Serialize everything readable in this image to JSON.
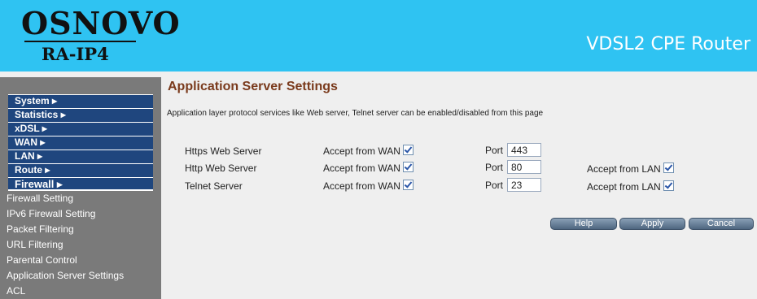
{
  "header": {
    "logo_main": "OSNOVO",
    "logo_sub": "RA-IP4",
    "title": "VDSL2 CPE Router"
  },
  "sidebar": {
    "menu": [
      {
        "label": "System ▸"
      },
      {
        "label": "Statistics ▸"
      },
      {
        "label": "xDSL ▸"
      },
      {
        "label": "WAN ▸"
      },
      {
        "label": "LAN ▸"
      },
      {
        "label": "Route ▸"
      },
      {
        "label": "Firewall ▸"
      }
    ],
    "submenu": [
      {
        "label": "Firewall Setting"
      },
      {
        "label": "IPv6 Firewall Setting"
      },
      {
        "label": "Packet Filtering"
      },
      {
        "label": "URL Filtering"
      },
      {
        "label": "Parental Control"
      },
      {
        "label": "Application Server Settings"
      },
      {
        "label": "ACL"
      }
    ]
  },
  "main": {
    "title": "Application Server Settings",
    "description": "Application layer protocol services like Web server, Telnet server can be enabled/disabled from this page",
    "rows": [
      {
        "service": "Https Web Server",
        "wan_label": "Accept from WAN",
        "wan_checked": true,
        "port_label": "Port",
        "port": "443",
        "lan_label": "",
        "lan_checked": false
      },
      {
        "service": "Http Web Server",
        "wan_label": "Accept from WAN",
        "wan_checked": true,
        "port_label": "Port",
        "port": "80",
        "lan_label": "Accept from LAN",
        "lan_checked": true
      },
      {
        "service": "Telnet Server",
        "wan_label": "Accept from WAN",
        "wan_checked": true,
        "port_label": "Port",
        "port": "23",
        "lan_label": "Accept from LAN",
        "lan_checked": true
      }
    ],
    "buttons": {
      "help": "Help",
      "apply": "Apply",
      "cancel": "Cancel"
    }
  },
  "colors": {
    "header_bg": "#2fc3f2",
    "menu_bg": "#1f467e",
    "sidebar_bg": "#7a7a7a",
    "title_color": "#7a3a1c"
  }
}
